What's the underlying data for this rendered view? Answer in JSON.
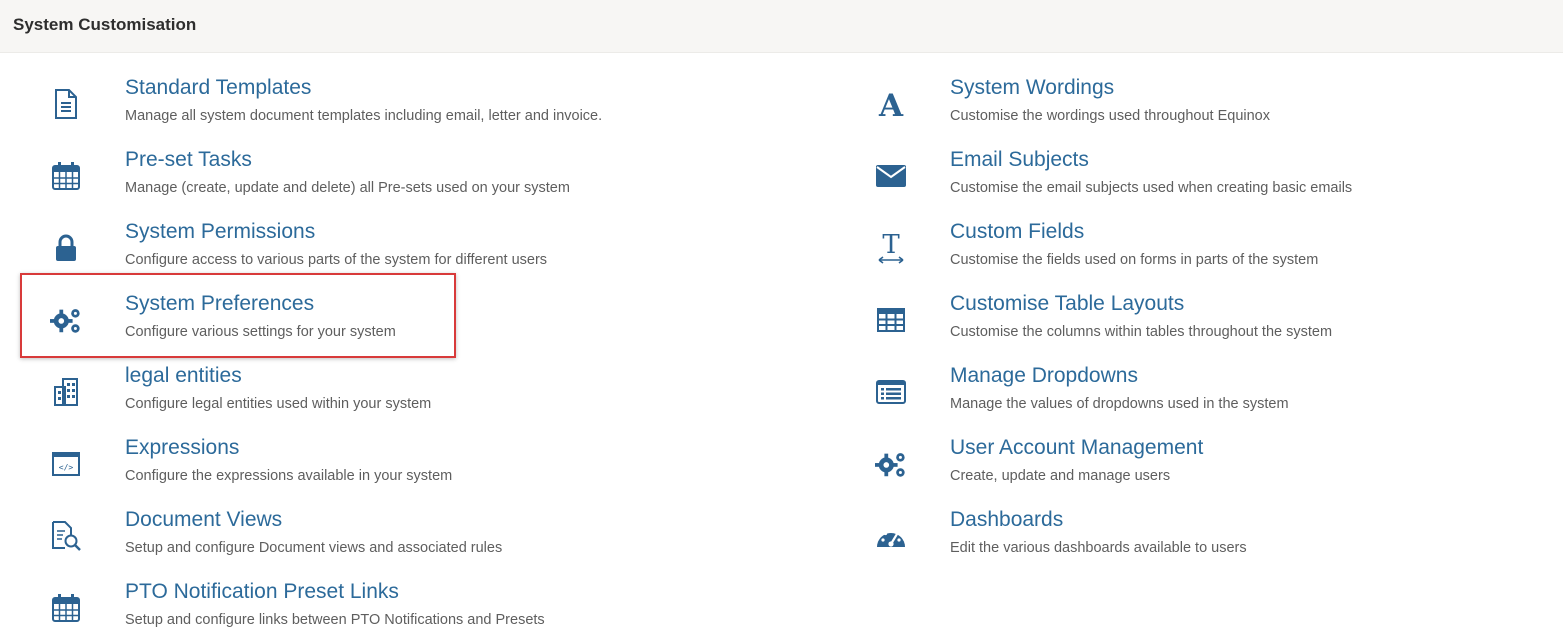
{
  "header": {
    "title": "System Customisation"
  },
  "left_items": [
    {
      "title": "Standard Templates",
      "desc": "Manage all system document templates including email, letter and invoice.",
      "icon": "document-icon"
    },
    {
      "title": "Pre-set Tasks",
      "desc": "Manage (create, update and delete) all Pre-sets used on your system",
      "icon": "calendar-icon"
    },
    {
      "title": "System Permissions",
      "desc": "Configure access to various parts of the system for different users",
      "icon": "lock-icon"
    },
    {
      "title": "System Preferences",
      "desc": "Configure various settings for your system",
      "icon": "gears-icon"
    },
    {
      "title": "legal entities",
      "desc": "Configure legal entities used within your system",
      "icon": "buildings-icon"
    },
    {
      "title": "Expressions",
      "desc": "Configure the expressions available in your system",
      "icon": "code-window-icon"
    },
    {
      "title": "Document Views",
      "desc": "Setup and configure Document views and associated rules",
      "icon": "document-search-icon"
    },
    {
      "title": "PTO Notification Preset Links",
      "desc": "Setup and configure links between PTO Notifications and Presets",
      "icon": "calendar-icon"
    }
  ],
  "right_items": [
    {
      "title": "System Wordings",
      "desc": "Customise the wordings used throughout Equinox",
      "icon": "font-icon"
    },
    {
      "title": "Email Subjects",
      "desc": "Customise the email subjects used when creating basic emails",
      "icon": "envelope-icon"
    },
    {
      "title": "Custom Fields",
      "desc": "Customise the fields used on forms in parts of the system",
      "icon": "text-width-icon"
    },
    {
      "title": "Customise Table Layouts",
      "desc": "Customise the columns within tables throughout the system",
      "icon": "table-icon"
    },
    {
      "title": "Manage Dropdowns",
      "desc": "Manage the values of dropdowns used in the system",
      "icon": "list-icon"
    },
    {
      "title": "User Account Management",
      "desc": "Create, update and manage users",
      "icon": "gears-icon"
    },
    {
      "title": "Dashboards",
      "desc": "Edit the various dashboards available to users",
      "icon": "dashboard-icon"
    }
  ],
  "colors": {
    "accent": "#2c6a9a",
    "icon": "#2c6291",
    "highlight": "#d83a3a"
  }
}
